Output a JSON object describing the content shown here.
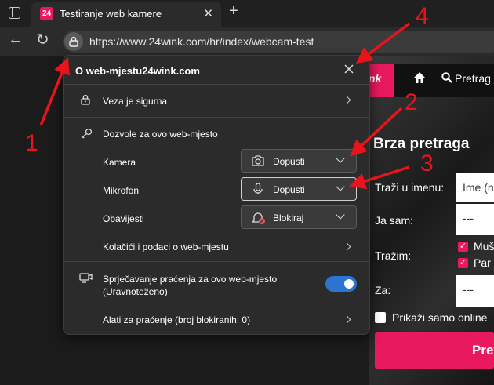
{
  "browser": {
    "tab_title": "Testiranje web kamere",
    "tab_favicon_text": "24",
    "url": "https://www.24wink.com/hr/index/webcam-test"
  },
  "site": {
    "logo_text": "nk",
    "nav_search_label": "Pretrag",
    "quick_search_title": "Brza pretraga",
    "name_label": "Traži u imenu:",
    "name_value": "Ime (n",
    "iam_label": "Ja sam:",
    "iam_value": "---",
    "seeking_label": "Tražim:",
    "seeking_options": [
      "Muš",
      "Par"
    ],
    "for_label": "Za:",
    "for_value": "---",
    "online_only_label": "Prikaži samo online",
    "search_button_label": "Pret",
    "accent_color": "#e8195f"
  },
  "popup": {
    "title": "O web-mjestu24wink.com",
    "connection_label": "Veza je sigurna",
    "permissions_heading": "Dozvole za ovo web-mjesto",
    "permissions": [
      {
        "label": "Kamera",
        "value": "Dopusti",
        "icon": "camera-icon"
      },
      {
        "label": "Mikrofon",
        "value": "Dopusti",
        "icon": "microphone-icon"
      },
      {
        "label": "Obavijesti",
        "value": "Blokiraj",
        "icon": "notification-blocked-icon"
      }
    ],
    "cookies_label": "Kolačići i podaci o web-mjestu",
    "tracking_label_line1": "Sprječavanje praćenja za ovo web-mjesto",
    "tracking_label_line2": "(Uravnoteženo)",
    "tracking_enabled": true,
    "trackers_label": "Alati za praćenje (broj blokiranih: 0)"
  },
  "annotations": {
    "numbers": [
      "1",
      "2",
      "3",
      "4"
    ],
    "color": "#e8141b"
  }
}
